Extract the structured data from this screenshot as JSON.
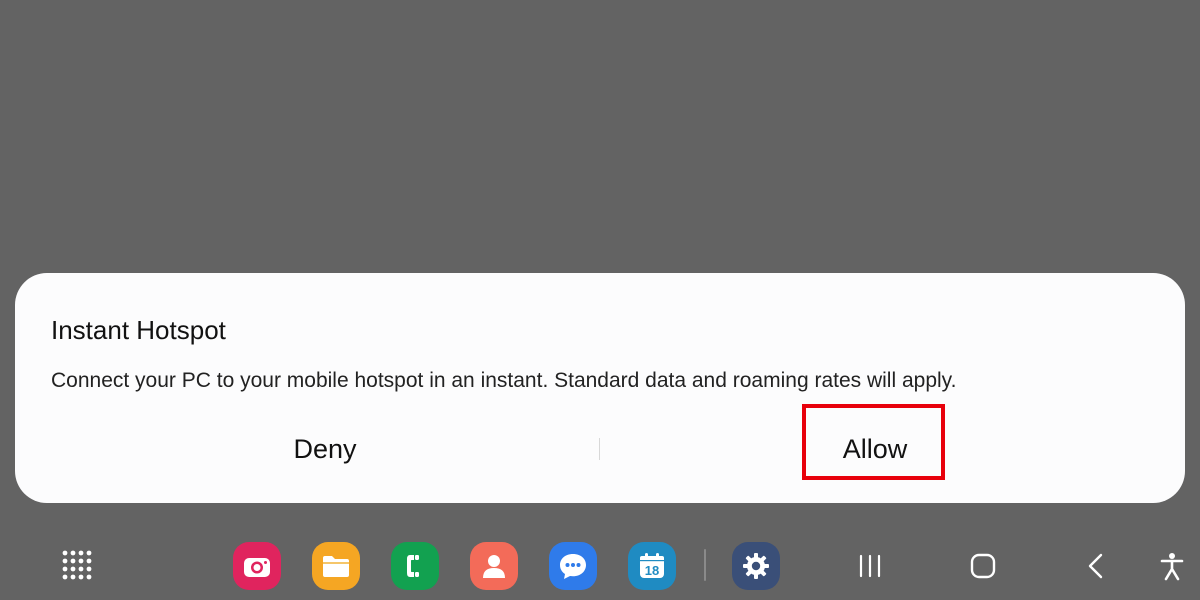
{
  "dialog": {
    "title": "Instant Hotspot",
    "message": "Connect your PC to your mobile hotspot in an instant. Standard data and roaming rates will apply.",
    "deny_label": "Deny",
    "allow_label": "Allow"
  },
  "taskbar": {
    "apps": [
      {
        "name": "camera-icon",
        "color": "#e0245e"
      },
      {
        "name": "folder-icon",
        "color": "#f5a623"
      },
      {
        "name": "phone-icon",
        "color": "#12a150"
      },
      {
        "name": "contacts-icon",
        "color": "#f36b59"
      },
      {
        "name": "messages-icon",
        "color": "#2f7bea"
      },
      {
        "name": "calendar-icon",
        "color": "#1f8bc2",
        "day": "18"
      },
      {
        "name": "settings-icon",
        "color": "#3a4f78"
      }
    ],
    "nav": [
      "recents-icon",
      "home-icon",
      "back-icon",
      "accessibility-icon"
    ]
  },
  "colors": {
    "backdrop": "#636363",
    "dialog_bg": "#fcfcfd",
    "highlight": "#e8000b"
  }
}
